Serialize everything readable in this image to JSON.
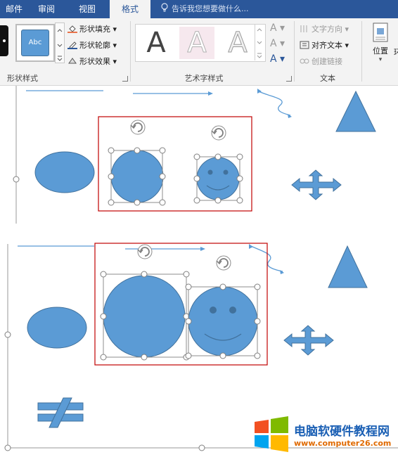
{
  "tabs": [
    "邮件",
    "审阅",
    "视图",
    "格式"
  ],
  "active_tab": "格式",
  "tell_me": "告诉我您想要做什么...",
  "shape_styles": {
    "group_label": "形状样式",
    "swatch_label": "Abc",
    "fill": "形状填充",
    "outline": "形状轮廓",
    "effects": "形状效果"
  },
  "wordart": {
    "group_label": "艺术字样式",
    "sample": "A"
  },
  "text_group": {
    "group_label": "文本",
    "direction": "文字方向",
    "align": "对齐文本",
    "link": "创建链接"
  },
  "arrange": {
    "position": "位置",
    "wrap_partial": "环"
  },
  "watermark": {
    "name": "电脑软硬件教程网",
    "url": "www.computer26.com"
  },
  "colors": {
    "ribbon_accent": "#2b579a",
    "shape_fill": "#5b9bd5",
    "selection_box": "#c00000"
  }
}
